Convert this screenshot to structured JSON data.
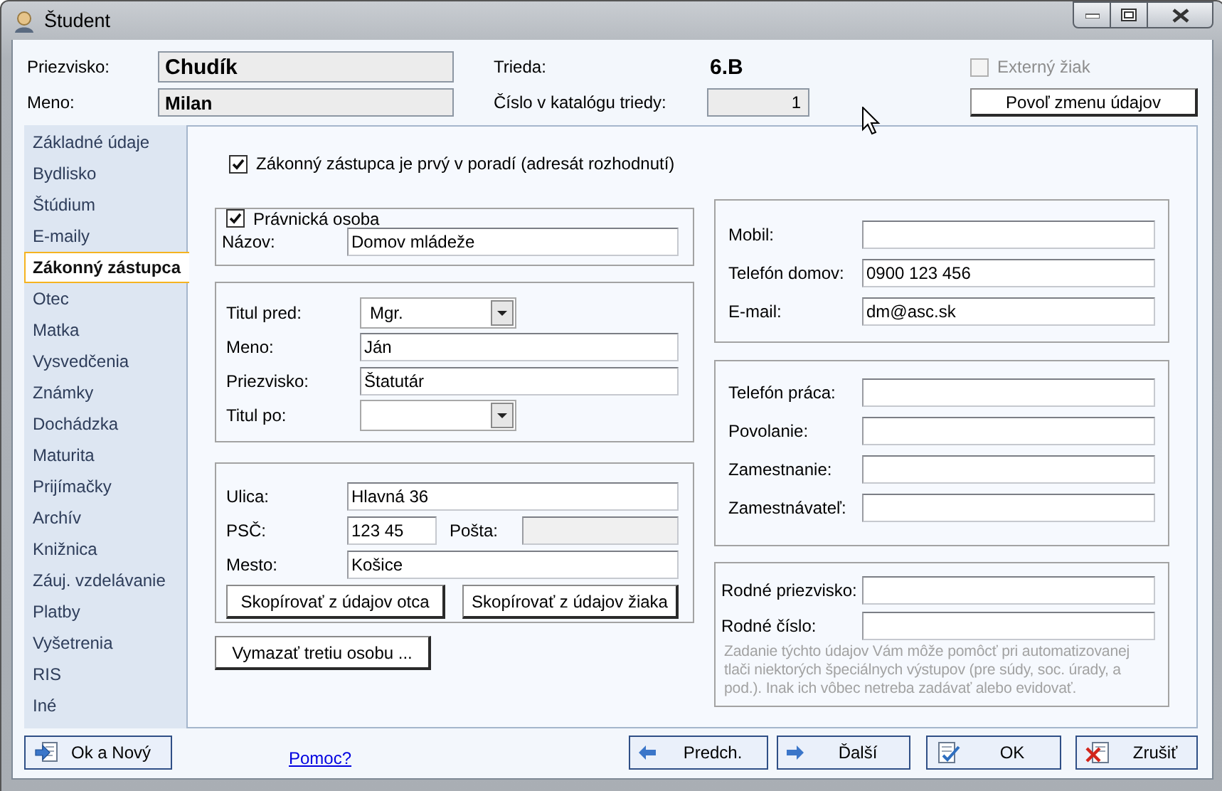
{
  "window": {
    "title": "Študent"
  },
  "header": {
    "surname": {
      "label": "Priezvisko:",
      "value": "Chudík"
    },
    "first_name": {
      "label": "Meno:",
      "value": "Milan"
    },
    "class": {
      "label": "Trieda:",
      "value": "6.B"
    },
    "catalog_number": {
      "label": "Číslo v katalógu triedy:",
      "value": "1"
    },
    "external": {
      "label": "Externý žiak",
      "checked": false,
      "disabled": true
    },
    "unlock_button": "Povoľ zmenu údajov"
  },
  "sidebar": {
    "items": [
      {
        "label": "Základné údaje",
        "selected": false
      },
      {
        "label": "Bydlisko",
        "selected": false
      },
      {
        "label": "Štúdium",
        "selected": false
      },
      {
        "label": "E-maily",
        "selected": false
      },
      {
        "label": "Zákonný zástupca",
        "selected": true
      },
      {
        "label": "Otec",
        "selected": false
      },
      {
        "label": "Matka",
        "selected": false
      },
      {
        "label": "Vysvedčenia",
        "selected": false
      },
      {
        "label": "Známky",
        "selected": false
      },
      {
        "label": "Dochádzka",
        "selected": false
      },
      {
        "label": "Maturita",
        "selected": false
      },
      {
        "label": "Prijímačky",
        "selected": false
      },
      {
        "label": "Archív",
        "selected": false
      },
      {
        "label": "Knižnica",
        "selected": false
      },
      {
        "label": "Záuj. vzdelávanie",
        "selected": false
      },
      {
        "label": "Platby",
        "selected": false
      },
      {
        "label": "Vyšetrenia",
        "selected": false
      },
      {
        "label": "RIS",
        "selected": false
      },
      {
        "label": "Iné",
        "selected": false
      }
    ]
  },
  "form": {
    "first_in_order": {
      "label": "Zákonný zástupca je prvý v poradí (adresát rozhodnutí)",
      "checked": true
    },
    "legal_entity": {
      "label": "Právnická osoba",
      "checked": true,
      "name": {
        "label": "Názov:",
        "value": "Domov mládeže"
      }
    },
    "person": {
      "fields": [
        {
          "kind": "select",
          "label": "Titul pred:",
          "value": "Mgr."
        },
        {
          "kind": "text",
          "label": "Meno:",
          "value": "Ján"
        },
        {
          "kind": "text",
          "label": "Priezvisko:",
          "value": "Štatutár"
        },
        {
          "kind": "select",
          "label": "Titul po:"
        }
      ]
    },
    "address": {
      "street": {
        "label": "Ulica:",
        "value": "Hlavná 36"
      },
      "zip": {
        "label": "PSČ:",
        "value": "123 45"
      },
      "post": {
        "label": "Pošta:",
        "disabled": true
      },
      "city": {
        "label": "Mesto:",
        "value": "Košice"
      },
      "buttons": [
        "Skopírovať z údajov otca",
        "Skopírovať z údajov žiaka"
      ]
    },
    "clear_button": "Vymazať tretiu osobu ...",
    "contacts": [
      {
        "label": "Mobil:"
      },
      {
        "label": "Telefón domov:",
        "value": "0900 123 456"
      },
      {
        "label": "E-mail:",
        "value": "dm@asc.sk"
      }
    ],
    "work": [
      {
        "label": "Telefón práca:"
      },
      {
        "label": "Povolanie:"
      },
      {
        "label": "Zamestnanie:"
      },
      {
        "label": "Zamestnávateľ:"
      }
    ],
    "birth": {
      "fields": [
        {
          "label": "Rodné priezvisko:"
        },
        {
          "label": "Rodné číslo:"
        }
      ],
      "note": "Zadanie týchto údajov Vám môže pomôcť pri automatizovanej tlači niektorých špeciálnych výstupov (pre súdy, soc. úrady, a pod.). Inak ich vôbec netreba zadávať alebo evidovať."
    }
  },
  "footer": {
    "left_button": {
      "label": "Ok a Nový",
      "kind": "ok-new"
    },
    "help_link": "Pomoc?",
    "buttons": [
      {
        "label": "Predch.",
        "kind": "prev"
      },
      {
        "label": "Ďalší",
        "kind": "next"
      },
      {
        "label": "OK",
        "kind": "ok"
      },
      {
        "label": "Zrušiť",
        "kind": "cancel"
      }
    ]
  }
}
